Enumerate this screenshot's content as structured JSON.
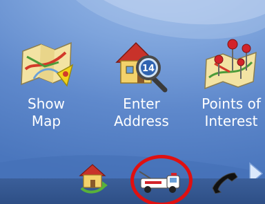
{
  "menu": {
    "tiles": [
      {
        "label": "Show\nMap",
        "icon": "map-flag-icon"
      },
      {
        "label": "Enter\nAddress",
        "icon": "house-magnifier-icon",
        "badge": "14"
      },
      {
        "label": "Points of\nInterest",
        "icon": "map-pins-icon"
      }
    ],
    "next_icon": "right-arrow-icon"
  },
  "bottom_bar": {
    "buttons": [
      {
        "icon": "home-arrow-icon"
      },
      {
        "icon": "tow-truck-icon",
        "highlighted": true
      },
      {
        "icon": "phone-icon"
      }
    ]
  },
  "colors": {
    "background": "#5f89cc",
    "label_text": "#ffffff",
    "highlight": "#e01010"
  }
}
